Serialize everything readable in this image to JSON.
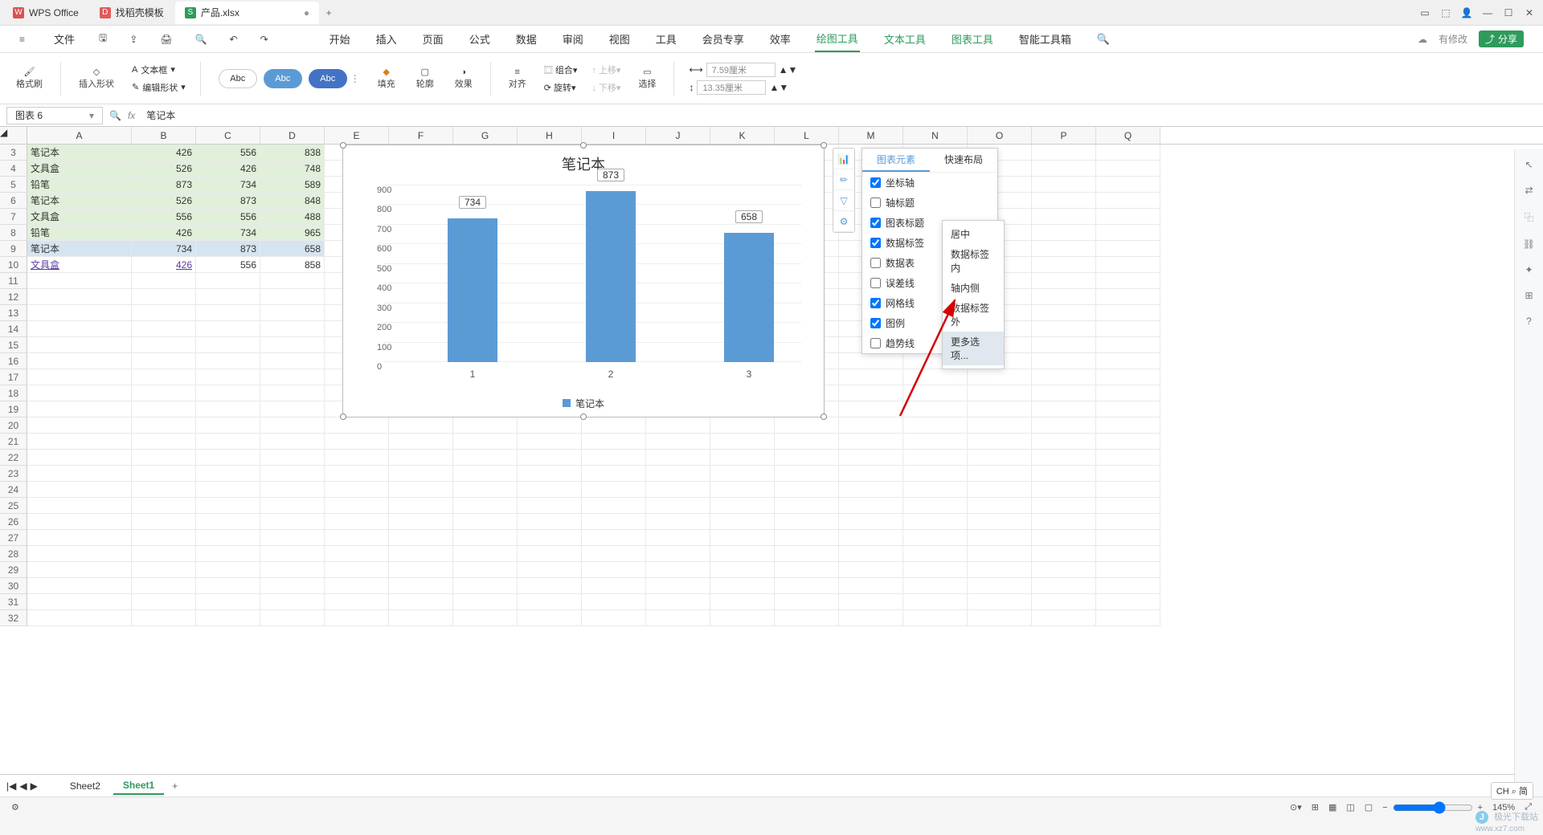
{
  "titlebar": {
    "tabs": [
      {
        "label": "WPS Office",
        "icon": "W",
        "color": "#d9534f"
      },
      {
        "label": "找稻壳模板",
        "icon": "D",
        "color": "#e25a5a"
      },
      {
        "label": "产品.xlsx",
        "icon": "S",
        "color": "#2e9b5c",
        "active": true,
        "dirty": "●"
      }
    ],
    "add": "+"
  },
  "qat": {
    "file": "文件",
    "items": [
      "三",
      "保存",
      "PDF",
      "打印",
      "刷新",
      "撤销",
      "重做"
    ]
  },
  "menu": {
    "items": [
      "开始",
      "插入",
      "页面",
      "公式",
      "数据",
      "审阅",
      "视图",
      "工具",
      "会员专享",
      "效率"
    ],
    "extra": [
      "绘图工具",
      "文本工具",
      "图表工具",
      "智能工具箱"
    ],
    "search_icon": "🔍",
    "modified": "有修改",
    "share": "分享"
  },
  "ribbon": {
    "format_painter": "格式刷",
    "insert_shape": "插入形状",
    "text_box": "文本框",
    "edit_shape": "编辑形状",
    "abc": "Abc",
    "fill": "填充",
    "outline": "轮廓",
    "effect": "效果",
    "align": "对齐",
    "group": "组合",
    "up": "上移",
    "down": "下移",
    "rotate": "旋转",
    "select": "选择",
    "width_val": "7.59厘米",
    "height_val": "13.35厘米"
  },
  "namebox": "图表 6",
  "formula": "笔记本",
  "columns": [
    "A",
    "B",
    "C",
    "D",
    "E",
    "F",
    "G",
    "H",
    "I",
    "J",
    "K",
    "L",
    "M",
    "N",
    "O",
    "P",
    "Q"
  ],
  "rownums": [
    3,
    4,
    5,
    6,
    7,
    8,
    9,
    10,
    11,
    12,
    13,
    14,
    15,
    16,
    17,
    18,
    19,
    20,
    21,
    22,
    23,
    24,
    25,
    26,
    27,
    28,
    29,
    30,
    31,
    32
  ],
  "table": [
    {
      "a": "笔记本",
      "b": 426,
      "c": 556,
      "d": 838,
      "green": true
    },
    {
      "a": "文具盒",
      "b": 526,
      "c": 426,
      "d": 748,
      "green": true
    },
    {
      "a": "铅笔",
      "b": 873,
      "c": 734,
      "d": 589,
      "green": true
    },
    {
      "a": "笔记本",
      "b": 526,
      "c": 873,
      "d": 848,
      "green": true
    },
    {
      "a": "文具盒",
      "b": 556,
      "c": 556,
      "d": 488,
      "green": true
    },
    {
      "a": "铅笔",
      "b": 426,
      "c": 734,
      "d": 965,
      "green": true
    },
    {
      "a": "笔记本",
      "b": 734,
      "c": 873,
      "d": 658,
      "sel": true
    },
    {
      "a": "文具盒",
      "b": 426,
      "c": 556,
      "d": 858,
      "link": true
    }
  ],
  "chart_data": {
    "type": "bar",
    "title": "笔记本",
    "categories": [
      "1",
      "2",
      "3"
    ],
    "values": [
      734,
      873,
      658
    ],
    "ylim": [
      0,
      900
    ],
    "ystep": 100,
    "legend_label": "笔记本"
  },
  "side_tools": [
    "📊",
    "✏",
    "▽",
    "⚙"
  ],
  "ce_panel": {
    "tab1": "图表元素",
    "tab2": "快速布局",
    "items": [
      {
        "label": "坐标轴",
        "checked": true
      },
      {
        "label": "轴标题",
        "checked": false
      },
      {
        "label": "图表标题",
        "checked": true
      },
      {
        "label": "数据标签",
        "checked": true,
        "arrow": true
      },
      {
        "label": "数据表",
        "checked": false
      },
      {
        "label": "误差线",
        "checked": false
      },
      {
        "label": "网格线",
        "checked": true
      },
      {
        "label": "图例",
        "checked": true
      },
      {
        "label": "趋势线",
        "checked": false
      }
    ]
  },
  "submenu": [
    "居中",
    "数据标签内",
    "轴内侧",
    "数据标签外",
    "更多选项..."
  ],
  "sheets": {
    "nav": [
      "|◀",
      "◀",
      "▶"
    ],
    "tabs": [
      "Sheet2",
      "Sheet1"
    ],
    "add": "+"
  },
  "status": {
    "lang": "CH ⌕ 简",
    "zoom": "145%",
    "items": [
      "⚙",
      "⊞",
      "▦",
      "□",
      "▣",
      "▢"
    ]
  },
  "watermark": {
    "name": "极光下载站",
    "url": "www.xz7.com"
  }
}
